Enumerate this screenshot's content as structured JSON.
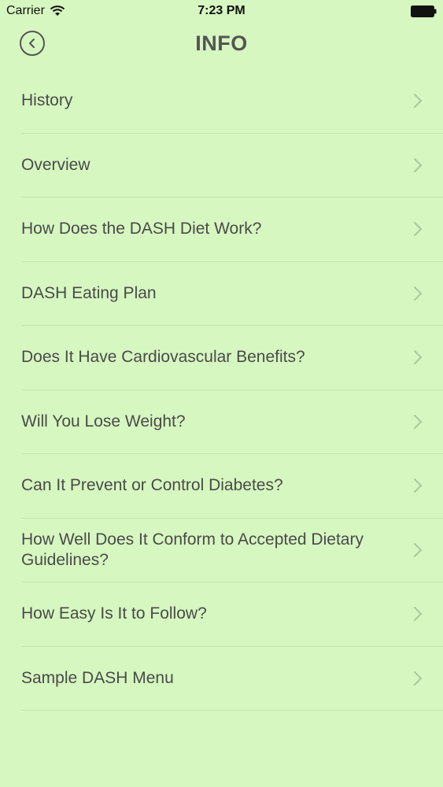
{
  "status_bar": {
    "carrier": "Carrier",
    "time": "7:23 PM"
  },
  "nav": {
    "title": "INFO",
    "back_icon": "back-circle-icon"
  },
  "menu": {
    "items": [
      {
        "label": "History"
      },
      {
        "label": "Overview"
      },
      {
        "label": "How Does the DASH Diet Work?"
      },
      {
        "label": "DASH Eating Plan"
      },
      {
        "label": "Does It Have Cardiovascular Benefits?"
      },
      {
        "label": "Will You Lose Weight?"
      },
      {
        "label": "Can It Prevent or Control Diabetes?"
      },
      {
        "label": "How Well Does It Conform to Accepted Dietary Guidelines?"
      },
      {
        "label": "How Easy Is It to Follow?"
      },
      {
        "label": "Sample DASH Menu"
      }
    ]
  },
  "colors": {
    "background": "#d6f7c0",
    "text": "#4a4a4a",
    "separator": "#c6e6b0",
    "chevron": "#a8c99a"
  }
}
